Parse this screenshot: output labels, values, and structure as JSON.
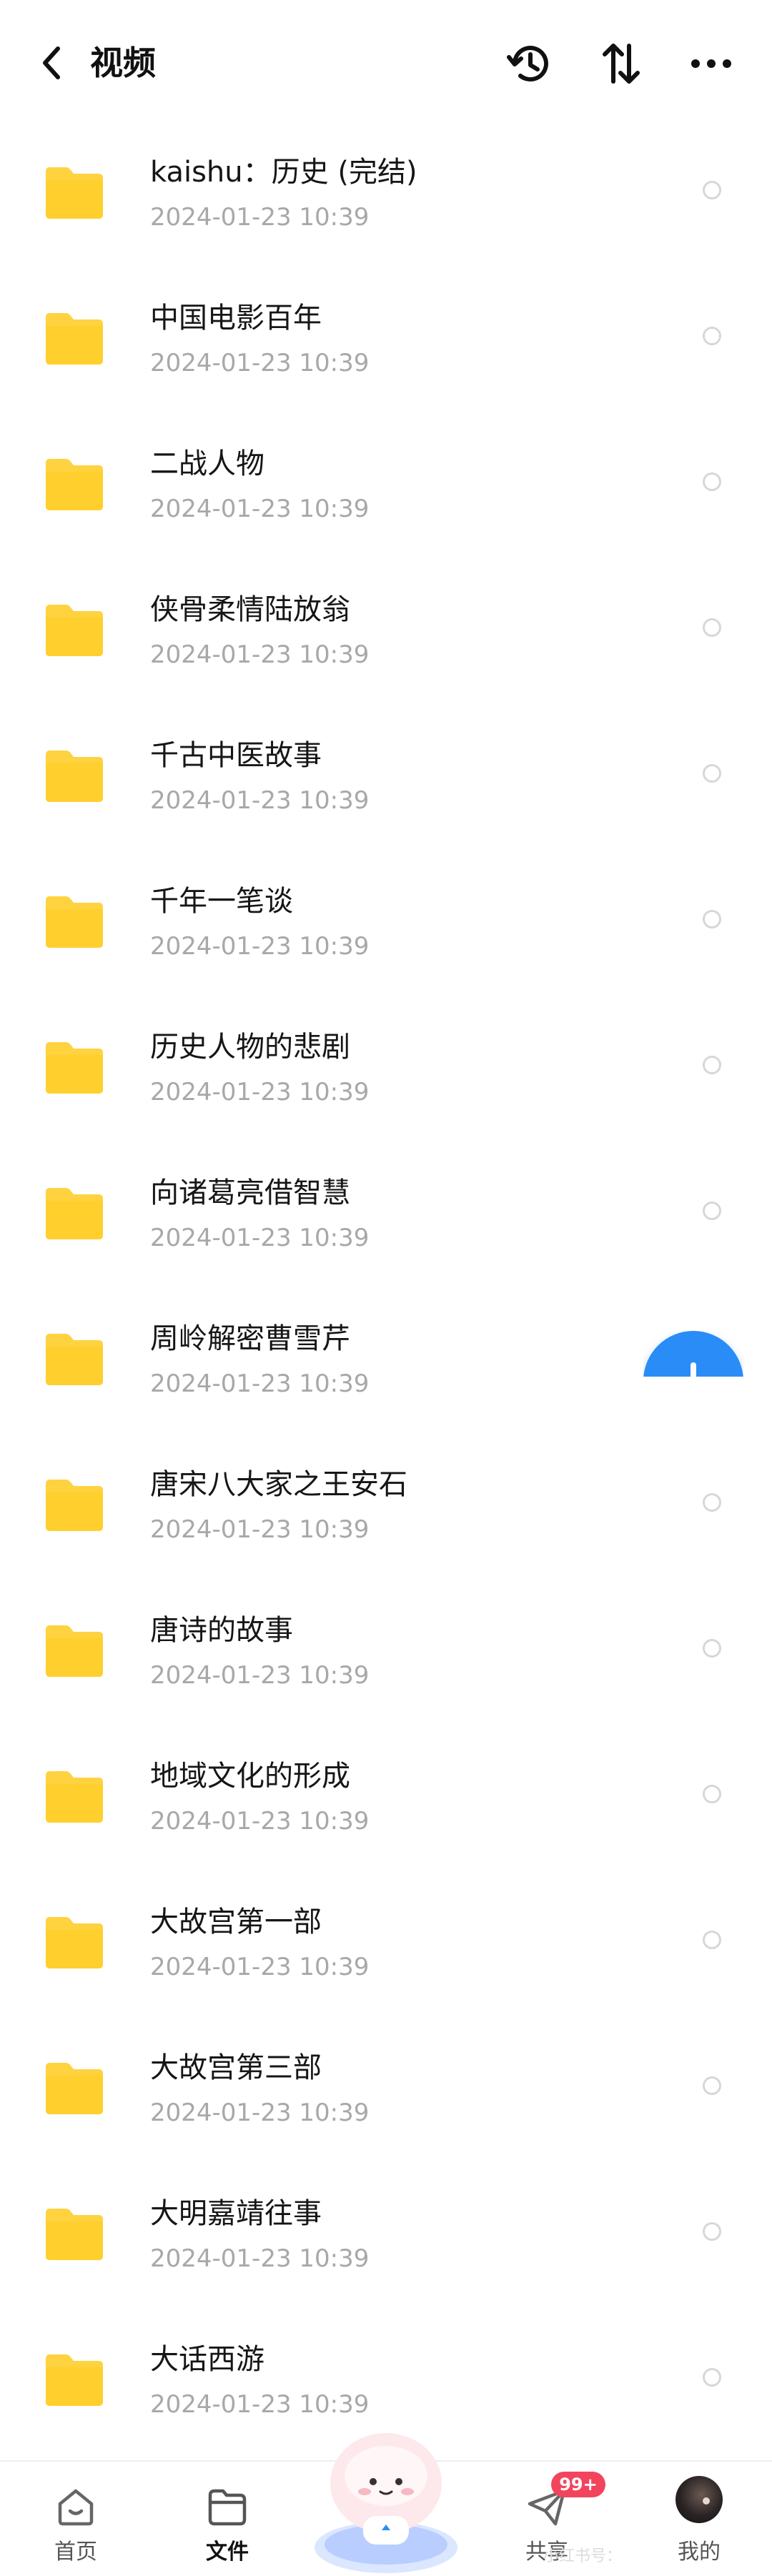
{
  "header": {
    "title": "视频",
    "icons": [
      "back-arrow-icon",
      "history-icon",
      "sort-icon",
      "more-icon"
    ]
  },
  "files": [
    {
      "name": "kaishu：历史 (完结)",
      "date": "2024-01-23  10:39"
    },
    {
      "name": "中国电影百年",
      "date": "2024-01-23  10:39"
    },
    {
      "name": "二战人物",
      "date": "2024-01-23  10:39"
    },
    {
      "name": "侠骨柔情陆放翁",
      "date": "2024-01-23  10:39"
    },
    {
      "name": "千古中医故事",
      "date": "2024-01-23  10:39"
    },
    {
      "name": "千年一笔谈",
      "date": "2024-01-23  10:39"
    },
    {
      "name": "历史人物的悲剧",
      "date": "2024-01-23  10:39"
    },
    {
      "name": "向诸葛亮借智慧",
      "date": "2024-01-23  10:39"
    },
    {
      "name": "周岭解密曹雪芹",
      "date": "2024-01-23  10:39"
    },
    {
      "name": "唐宋八大家之王安石",
      "date": "2024-01-23  10:39"
    },
    {
      "name": "唐诗的故事",
      "date": "2024-01-23  10:39"
    },
    {
      "name": "地域文化的形成",
      "date": "2024-01-23  10:39"
    },
    {
      "name": "大故宫第一部",
      "date": "2024-01-23  10:39"
    },
    {
      "name": "大故宫第三部",
      "date": "2024-01-23  10:39"
    },
    {
      "name": "大明嘉靖往事",
      "date": "2024-01-23  10:39"
    },
    {
      "name": "大话西游",
      "date": "2024-01-23  10:39"
    }
  ],
  "bottom_nav": {
    "items": [
      {
        "label": "首页",
        "icon": "home-icon",
        "active": false
      },
      {
        "label": "文件",
        "icon": "folder-icon",
        "active": true
      },
      {
        "label": "共享",
        "icon": "share-icon",
        "active": false,
        "badge": "99+"
      },
      {
        "label": "我的",
        "icon": "avatar",
        "active": false
      }
    ]
  },
  "watermark": "小红书号：",
  "colors": {
    "folder": "#ffd23f",
    "accent": "#2a8cf7",
    "badge": "#f2455d",
    "date_text": "#a8a8a8"
  }
}
